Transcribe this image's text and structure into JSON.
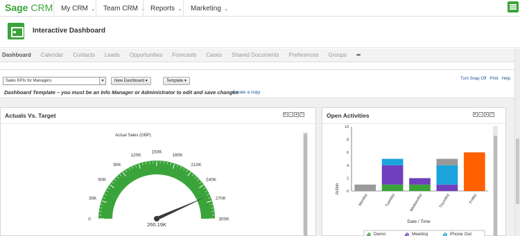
{
  "app": {
    "brand_sage": "Sage",
    "brand_crm": "CRM"
  },
  "topnav": {
    "items": [
      {
        "label": "My CRM"
      },
      {
        "label": "Team CRM"
      },
      {
        "label": "Reports"
      },
      {
        "label": "Marketing"
      }
    ]
  },
  "header": {
    "title": "Interactive Dashboard"
  },
  "tabs": [
    {
      "label": "Dashboard"
    },
    {
      "label": "Calendar"
    },
    {
      "label": "Contacts"
    },
    {
      "label": "Leads"
    },
    {
      "label": "Opportunities"
    },
    {
      "label": "Forecasts"
    },
    {
      "label": "Cases"
    },
    {
      "label": "Shared Documents"
    },
    {
      "label": "Preferences"
    },
    {
      "label": "Groups"
    },
    {
      "label": "•••"
    }
  ],
  "toolbar": {
    "dashboard_select": "Sales KPIs for Managers",
    "new_dashboard": "New Dashboard ▾",
    "template": "Template ▾",
    "turn_snap_off": "Turn Snap Off",
    "print": "Print",
    "help": "Help"
  },
  "notice": {
    "text": "Dashboard Template – you must be an Info Manager or Administrator to edit and save changes",
    "create_copy": "Create a copy"
  },
  "actuals_panel": {
    "title": "Actuals Vs. Target",
    "gauge": {
      "title": "Actual Sales (GBP)",
      "min": 0,
      "max": 300000,
      "value": 260190,
      "value_label": "260.19K",
      "tick_labels": [
        "0",
        "30K",
        "60K",
        "90K",
        "120K",
        "150K",
        "180K",
        "210K",
        "240K",
        "270K",
        "300K"
      ],
      "color": "#3aa43a"
    }
  },
  "activities_panel": {
    "title": "Open Activities",
    "chart_data": {
      "type": "bar",
      "stacked": true,
      "categories": [
        "Monday",
        "Tuesday",
        "Wednesday",
        "Thursday",
        "Friday"
      ],
      "xlabel": "Date / Time",
      "ylabel": "Action",
      "ylim": [
        0,
        10
      ],
      "yticks": [
        "0",
        "2",
        "4",
        "6",
        "8",
        "10"
      ],
      "series": [
        {
          "name": "Demo",
          "color": "#3aa43a",
          "values": [
            0,
            1,
            1,
            0,
            0
          ]
        },
        {
          "name": "Meeting",
          "color": "#6f3fbf",
          "values": [
            0,
            3,
            1,
            1,
            0
          ]
        },
        {
          "name": "Phone Out",
          "color": "#1aa3dd",
          "values": [
            0,
            1,
            0,
            3,
            0
          ]
        },
        {
          "color": "#999999",
          "values": [
            1,
            0,
            0,
            1,
            0
          ]
        },
        {
          "color": "#ff6000",
          "values": [
            0,
            0,
            0,
            0,
            6
          ]
        }
      ]
    }
  }
}
